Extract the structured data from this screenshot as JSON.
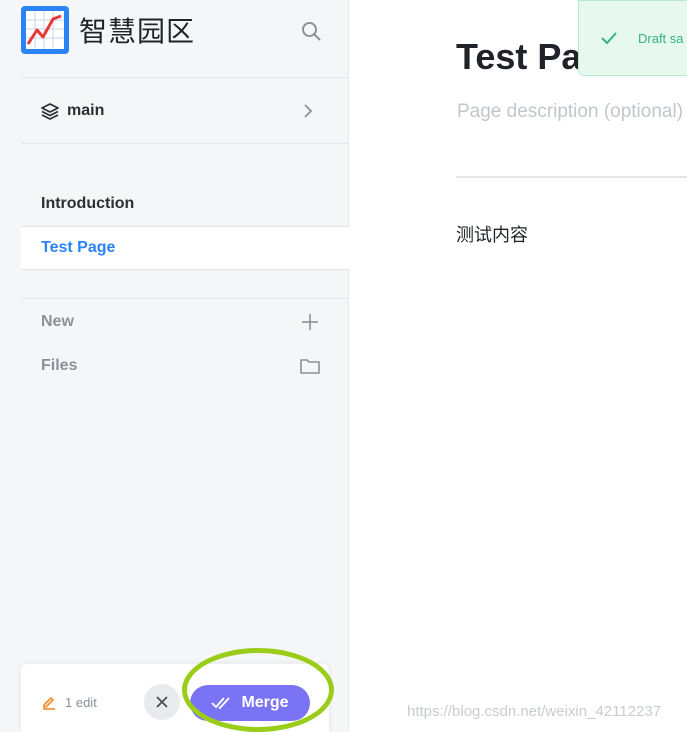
{
  "app": {
    "name": "智慧园区",
    "logo_icon": "trend-chart-logo-icon"
  },
  "sidebar": {
    "search_icon": "search-icon",
    "branch": {
      "label": "main",
      "icon": "layers-icon",
      "chevron": "chevron-right-icon"
    },
    "pages": [
      {
        "label": "Introduction",
        "active": false
      },
      {
        "label": "Test Page",
        "active": true
      }
    ],
    "tools": [
      {
        "label": "New",
        "icon": "plus-icon"
      },
      {
        "label": "Files",
        "icon": "folder-icon"
      }
    ]
  },
  "editbar": {
    "edit_count": "1 edit",
    "discard_icon": "close-icon",
    "merge_label": "Merge"
  },
  "main": {
    "title": "Test Pa",
    "description_placeholder": "Page description (optional)",
    "body": "测试内容"
  },
  "toast": {
    "text": "Draft sa",
    "icon": "check-icon"
  },
  "watermark": "https://blog.csdn.net/weixin_42112237",
  "colors": {
    "accent": "#2b83f6",
    "merge": "#7b73f6",
    "toast_green": "#35b57a",
    "highlight": "#9acd1a"
  }
}
